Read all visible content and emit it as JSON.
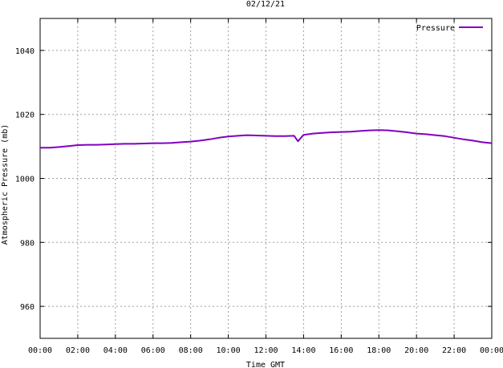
{
  "chart_data": {
    "type": "line",
    "title": "02/12/21",
    "xlabel": "Time GMT",
    "ylabel": "Atmospheric Pressure (mb)",
    "ylim": [
      950,
      1050
    ],
    "xlim": [
      0,
      24
    ],
    "x_tick_labels": [
      "00:00",
      "02:00",
      "04:00",
      "06:00",
      "08:00",
      "10:00",
      "12:00",
      "14:00",
      "16:00",
      "18:00",
      "20:00",
      "22:00",
      "00:00"
    ],
    "y_ticks": [
      960,
      980,
      1000,
      1020,
      1040
    ],
    "grid": true,
    "legend_position": "top-right",
    "series": [
      {
        "name": "Pressure",
        "color": "#8000c0",
        "x": [
          0,
          0.5,
          1,
          1.5,
          2,
          2.5,
          3,
          3.5,
          4,
          4.5,
          5,
          5.5,
          6,
          6.5,
          7,
          7.5,
          8,
          8.5,
          9,
          9.5,
          10,
          10.5,
          11,
          11.5,
          12,
          12.5,
          13,
          13.5,
          13.7,
          14,
          14.5,
          15,
          15.5,
          16,
          16.5,
          17,
          17.5,
          18,
          18.5,
          19,
          19.5,
          20,
          20.5,
          21,
          21.5,
          22,
          22.5,
          23,
          23.5,
          24
        ],
        "y": [
          1009.6,
          1009.6,
          1009.8,
          1010.1,
          1010.4,
          1010.5,
          1010.5,
          1010.6,
          1010.7,
          1010.8,
          1010.8,
          1010.9,
          1011.0,
          1011.0,
          1011.1,
          1011.3,
          1011.5,
          1011.8,
          1012.2,
          1012.7,
          1013.1,
          1013.3,
          1013.5,
          1013.4,
          1013.3,
          1013.2,
          1013.2,
          1013.3,
          1011.6,
          1013.6,
          1014.0,
          1014.2,
          1014.4,
          1014.5,
          1014.6,
          1014.8,
          1015.0,
          1015.1,
          1015.0,
          1014.7,
          1014.4,
          1014.0,
          1013.8,
          1013.5,
          1013.2,
          1012.7,
          1012.2,
          1011.8,
          1011.3,
          1011.0
        ]
      }
    ]
  }
}
